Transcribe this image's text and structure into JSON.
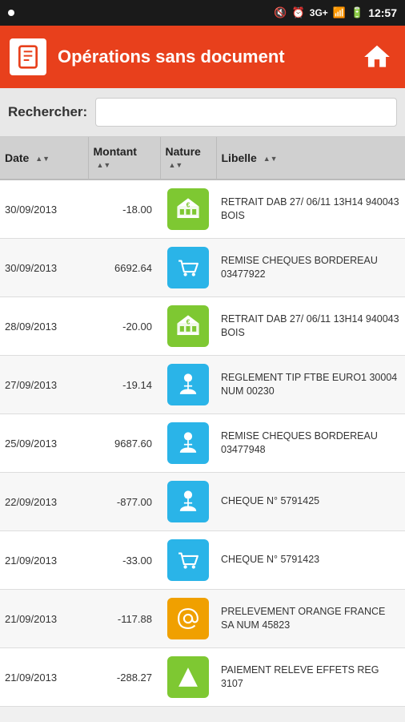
{
  "statusBar": {
    "time": "12:57",
    "network": "3G+"
  },
  "header": {
    "title": "Opérations sans document",
    "homeLabel": "🏠"
  },
  "search": {
    "label": "Rechercher:",
    "placeholder": ""
  },
  "table": {
    "columns": [
      {
        "label": "Date",
        "sortable": true
      },
      {
        "label": "Montant",
        "sortable": true
      },
      {
        "label": "Nature",
        "sortable": true
      },
      {
        "label": "Libelle",
        "sortable": true
      }
    ],
    "rows": [
      {
        "date": "30/09/2013",
        "montant": "-18.00",
        "nature": "bank-green",
        "libelle": "RETRAIT DAB 27/ 06/11 13H14 940043 BOIS"
      },
      {
        "date": "30/09/2013",
        "montant": "6692.64",
        "nature": "cart-blue",
        "libelle": "REMISE CHEQUES BORDEREAU 03477922"
      },
      {
        "date": "28/09/2013",
        "montant": "-20.00",
        "nature": "bank-green",
        "libelle": "RETRAIT DAB 27/ 06/11 13H14 940043 BOIS"
      },
      {
        "date": "27/09/2013",
        "montant": "-19.14",
        "nature": "person-blue",
        "libelle": "REGLEMENT TIP FTBE EURO1 30004 NUM 00230"
      },
      {
        "date": "25/09/2013",
        "montant": "9687.60",
        "nature": "person-blue",
        "libelle": "REMISE CHEQUES BORDEREAU 03477948"
      },
      {
        "date": "22/09/2013",
        "montant": "-877.00",
        "nature": "person-blue",
        "libelle": "CHEQUE N° 5791425"
      },
      {
        "date": "21/09/2013",
        "montant": "-33.00",
        "nature": "cart-blue",
        "libelle": "CHEQUE N° 5791423"
      },
      {
        "date": "21/09/2013",
        "montant": "-117.88",
        "nature": "at-orange",
        "libelle": "PRELEVEMENT ORANGE FRANCE SA NUM 45823"
      },
      {
        "date": "21/09/2013",
        "montant": "-288.27",
        "nature": "chart-green",
        "libelle": "PAIEMENT RELEVE EFFETS REG 3107"
      }
    ]
  }
}
